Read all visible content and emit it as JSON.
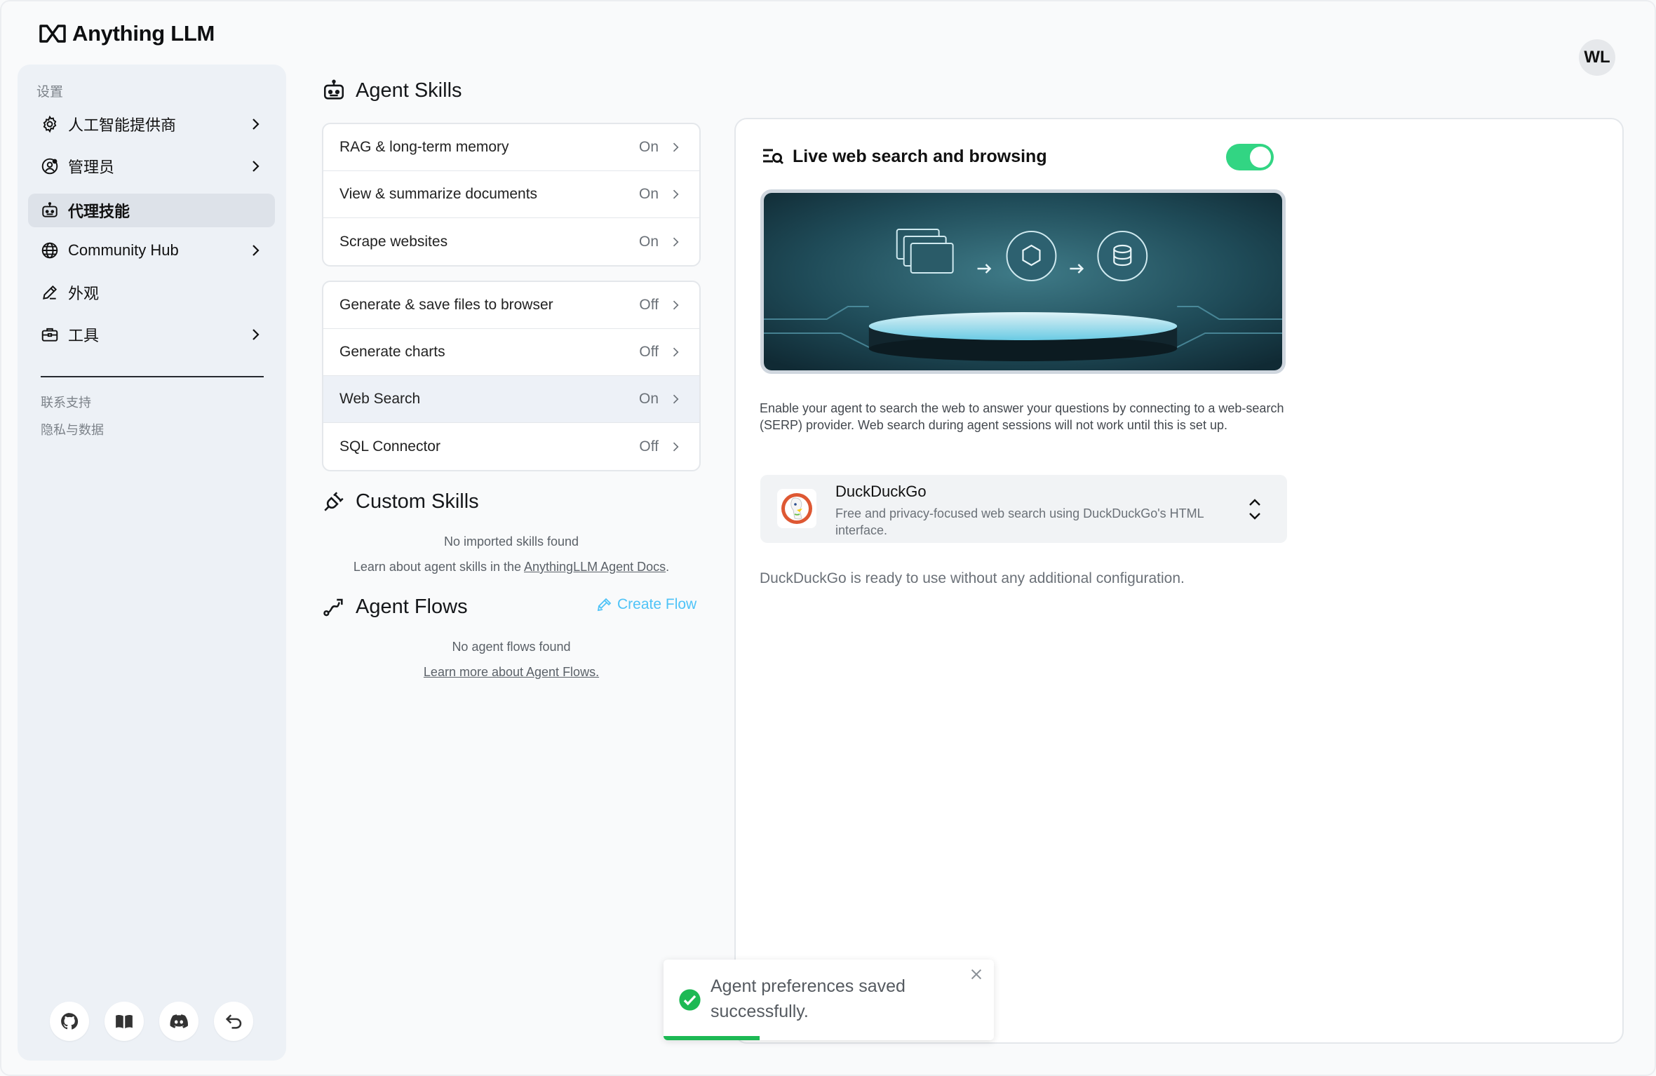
{
  "app": {
    "name": "Anything LLM",
    "user_initials": "WL"
  },
  "sidebar": {
    "heading": "设置",
    "items": [
      {
        "label": "人工智能提供商",
        "icon": "gear-icon",
        "has_chevron": true,
        "active": false
      },
      {
        "label": "管理员",
        "icon": "user-gear-icon",
        "has_chevron": true,
        "active": false
      },
      {
        "label": "代理技能",
        "icon": "robot-icon",
        "has_chevron": false,
        "active": true
      },
      {
        "label": "Community Hub",
        "icon": "globe-icon",
        "has_chevron": true,
        "active": false
      },
      {
        "label": "外观",
        "icon": "pencil-icon",
        "has_chevron": false,
        "active": false
      },
      {
        "label": "工具",
        "icon": "toolbox-icon",
        "has_chevron": true,
        "active": false
      }
    ],
    "links": [
      "联系支持",
      "隐私与数据"
    ],
    "footer_icons": [
      "github-icon",
      "book-icon",
      "discord-icon",
      "back-icon"
    ]
  },
  "agent_skills": {
    "title": "Agent Skills",
    "group1": [
      {
        "label": "RAG & long-term memory",
        "state": "On"
      },
      {
        "label": "View & summarize documents",
        "state": "On"
      },
      {
        "label": "Scrape websites",
        "state": "On"
      }
    ],
    "group2": [
      {
        "label": "Generate & save files to browser",
        "state": "Off"
      },
      {
        "label": "Generate charts",
        "state": "Off"
      },
      {
        "label": "Web Search",
        "state": "On",
        "selected": true
      },
      {
        "label": "SQL Connector",
        "state": "Off"
      }
    ]
  },
  "custom_skills": {
    "title": "Custom Skills",
    "empty": "No imported skills found",
    "learn_prefix": "Learn about agent skills in the ",
    "learn_link": "AnythingLLM Agent Docs",
    "learn_suffix": "."
  },
  "agent_flows": {
    "title": "Agent Flows",
    "create_label": "Create Flow",
    "empty": "No agent flows found",
    "learn_link": "Learn more about Agent Flows."
  },
  "detail": {
    "title": "Live web search and browsing",
    "enabled": true,
    "description": "Enable your agent to search the web to answer your questions by connecting to a web-search (SERP) provider. Web search during agent sessions will not work until this is set up.",
    "provider": {
      "name": "DuckDuckGo",
      "description": "Free and privacy-focused web search using DuckDuckGo's HTML interface."
    },
    "ready_text": "DuckDuckGo is ready to use without any additional configuration."
  },
  "toast": {
    "message": "Agent preferences saved successfully.",
    "progress": 0.29
  },
  "colors": {
    "accent": "#32d583",
    "link": "#4fc3f7",
    "success": "#1db954"
  }
}
